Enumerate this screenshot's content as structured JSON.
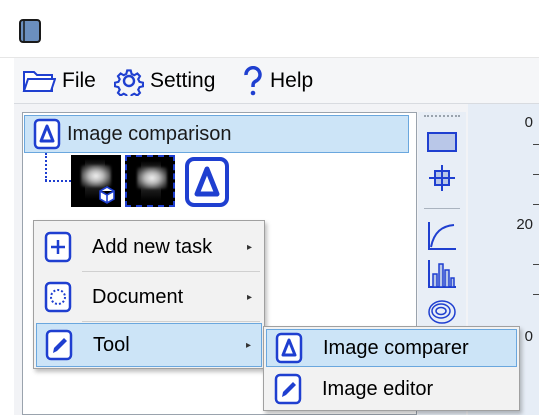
{
  "menu": {
    "file_label": "File",
    "setting_label": "Setting",
    "help_label": "Help"
  },
  "tree": {
    "root_label": "Image comparison"
  },
  "ruler": {
    "ticks": [
      "0",
      "20",
      "0"
    ]
  },
  "context_menu": {
    "items": [
      {
        "label": "Add new task",
        "icon": "add-document-icon",
        "has_submenu": true
      },
      {
        "label": "Document",
        "icon": "document-icon",
        "has_submenu": true
      },
      {
        "label": "Tool",
        "icon": "pen-icon",
        "has_submenu": true,
        "selected": true
      }
    ],
    "arrow": "▸"
  },
  "submenu": {
    "items": [
      {
        "label": "Image comparer",
        "icon": "delta-icon",
        "selected": true
      },
      {
        "label": "Image editor",
        "icon": "pen-icon"
      }
    ]
  },
  "colors": {
    "accent": "#1f3fd0",
    "selection": "#cce4f7",
    "selection_border": "#6aa7de"
  }
}
